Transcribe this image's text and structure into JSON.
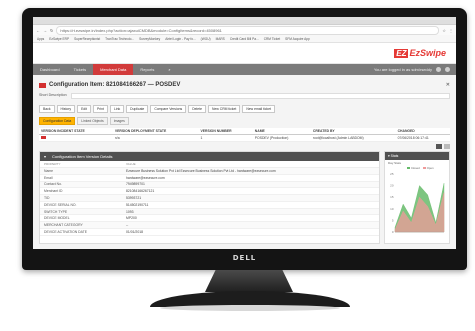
{
  "browser": {
    "url": "https://rt.ezswipe.in/index.php?action=ajaxuiCMDB&module=ConfigItems&record=4508961",
    "bookmarks": [
      "Apps",
      "EzSwipe ERP",
      "SuperReceptionist",
      "TranTrac Technolo...",
      "SurveyMonkey",
      "Airtel Login - Pay fo...",
      "(WGU)",
      "MARS",
      "Credit Card Bill Pa...",
      "CRM Ticket",
      "SFM Acquire App"
    ]
  },
  "app": {
    "logo_box": "EZ",
    "logo_text": "EzSwipe"
  },
  "nav": {
    "items": [
      "Dashboard",
      "Tickets",
      "Merchant Data",
      "Reports"
    ],
    "active_index": 2,
    "user_text": "You are logged in as sdm\\rseddy"
  },
  "page": {
    "title": "Configuration Item: 821084166267 — POSDEV",
    "description_label": "Short Description"
  },
  "actions": [
    "Back",
    "History",
    "Edit",
    "Print",
    "Link",
    "Duplicate",
    "Compare Versions",
    "Delete",
    "New CRM ticket",
    "New email ticket"
  ],
  "subtabs": [
    "Configuration Data",
    "Linked Objects",
    "Images"
  ],
  "info_table": {
    "headers": [
      "VERSION INCIDENT STATE",
      "VERSION DEPLOYMENT STATE",
      "VERSION NUMBER",
      "NAME",
      "CREATED BY",
      "CHANGED"
    ],
    "row": [
      "",
      "n/a",
      "1",
      "POSDEV (Production)",
      "root@localhost (Admin LABDOM)",
      "07/06/2018 06:17:41"
    ]
  },
  "details": {
    "title": "Configuration Item Version Details",
    "col_property": "PROPERTY",
    "col_value": "VALUE",
    "rows": [
      {
        "k": "Name",
        "v": "Ezsecure Business Solution Pvt Ltd Ezsecure Business Solution Pvt Ltd - hardware@ezsecure.com"
      },
      {
        "k": "Email",
        "v": "hardware@ezsecure.com"
      },
      {
        "k": "Contact No.",
        "v": "7949899701"
      },
      {
        "k": "Merchant ID",
        "v": "821084166267121"
      },
      {
        "k": "TID",
        "v": "53993721"
      },
      {
        "k": "DEVICE SERIAL NO.",
        "v": "514502190711"
      },
      {
        "k": "SWITCH TYPE",
        "v": "1093"
      },
      {
        "k": "DEVICE MODEL",
        "v": "MP200"
      },
      {
        "k": "MERCHANT CATEGORY",
        "v": "--"
      },
      {
        "k": "DEVICE ACTIVATION DATE",
        "v": "01/01/2018"
      }
    ]
  },
  "side_chart": {
    "panel_title": "▾ Stats",
    "subtitle": "Day Stats",
    "legend": [
      "Closed",
      "Open"
    ],
    "colors": {
      "closed": "#66bb6a",
      "open": "#ef9a9a"
    }
  },
  "chart_data": {
    "type": "area",
    "title": "Day Stats",
    "x": [
      1,
      2,
      3,
      4,
      5,
      6,
      7
    ],
    "ylim": [
      0,
      25
    ],
    "yticks": [
      0,
      5,
      10,
      15,
      20,
      25
    ],
    "series": [
      {
        "name": "Closed",
        "values": [
          2,
          12,
          6,
          20,
          16,
          4,
          21
        ]
      },
      {
        "name": "Open",
        "values": [
          1,
          9,
          4,
          15,
          11,
          3,
          17
        ]
      }
    ],
    "legend": "top-right",
    "grid": false
  },
  "monitor": {
    "brand": "DELL"
  }
}
